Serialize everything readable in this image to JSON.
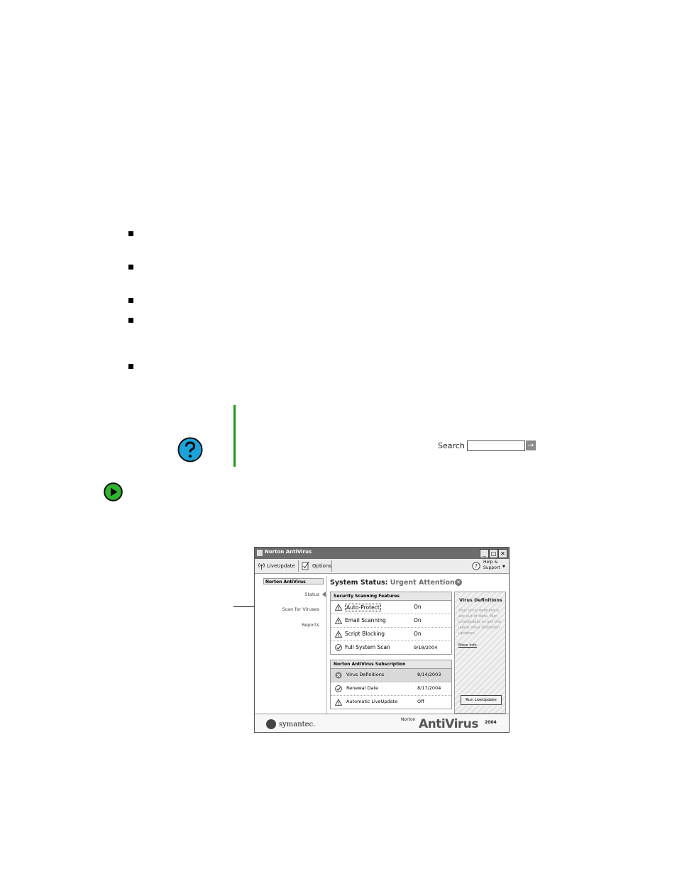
{
  "search": {
    "label": "Search",
    "go_glyph": "→"
  },
  "norton": {
    "window_title": "Norton AntiVirus",
    "window_buttons": [
      "_",
      "□",
      "✕"
    ],
    "toolbar": {
      "liveupdate": "LiveUpdate",
      "options": "Options",
      "help_line1": "Help &",
      "help_line2": "Support"
    },
    "nav": {
      "header": "Norton AntiVirus",
      "items": [
        "Status",
        "Scan for Viruses",
        "Reports"
      ]
    },
    "status": {
      "prefix": "System Status:",
      "state": "Urgent Attention",
      "badge": "✕"
    },
    "scanning": {
      "title": "Security Scanning Features",
      "rows": [
        {
          "icon": "warning-icon",
          "label": "Auto-Protect",
          "value": "On"
        },
        {
          "icon": "warning-icon",
          "label": "Email Scanning",
          "value": "On"
        },
        {
          "icon": "warning-icon",
          "label": "Script Blocking",
          "value": "On"
        },
        {
          "icon": "check-icon",
          "label": "Full System Scan",
          "value": "9/18/2004"
        }
      ]
    },
    "subscription": {
      "title": "Norton AntiVirus Subscription",
      "rows": [
        {
          "icon": "error-icon",
          "label": "Virus Definitions",
          "value": "8/14/2003"
        },
        {
          "icon": "check-icon",
          "label": "Renewal Date",
          "value": "8/17/2004"
        },
        {
          "icon": "warning-icon",
          "label": "Automatic LiveUpdate",
          "value": "Off"
        }
      ]
    },
    "side": {
      "title": "Virus Definitions",
      "text": "Your virus definitions are out of date. Run LiveUpdate to get the latest virus definition updates.",
      "link": "More Info",
      "button": "Run LiveUpdate"
    },
    "footer": {
      "brand": "symantec.",
      "product_small": "Norton",
      "product_big": "AntiVirus",
      "year": "2004"
    }
  }
}
